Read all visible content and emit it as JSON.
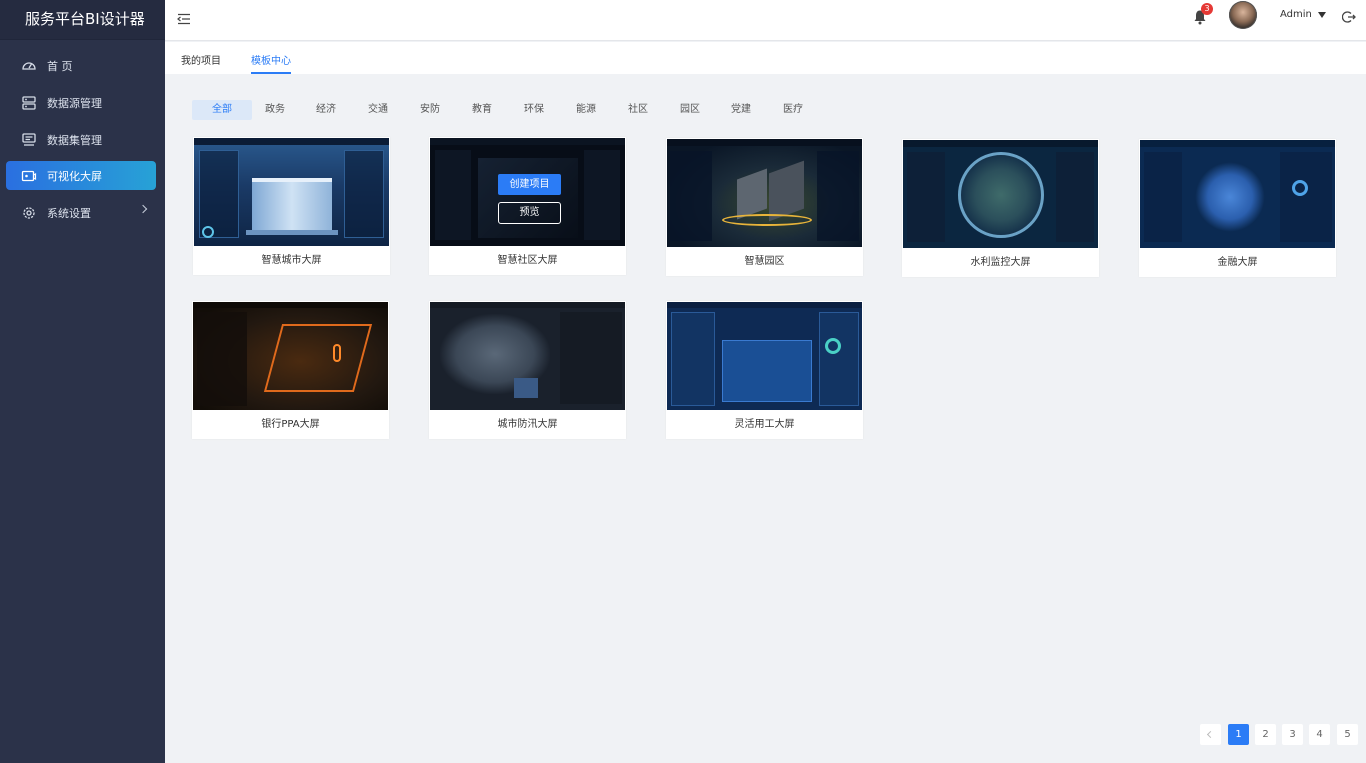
{
  "app": {
    "title": "服务平台BI设计器"
  },
  "sidebar": {
    "items": [
      {
        "label": "首 页",
        "icon": "dashboard-icon"
      },
      {
        "label": "数据源管理",
        "icon": "database-icon"
      },
      {
        "label": "数据集管理",
        "icon": "dataset-icon"
      },
      {
        "label": "可视化大屏",
        "icon": "screen-icon"
      },
      {
        "label": "系统设置",
        "icon": "gear-icon"
      }
    ]
  },
  "header": {
    "notif_count": "3",
    "user": "Admin"
  },
  "tabs": [
    "我的项目",
    "模板中心"
  ],
  "categories": [
    "全部",
    "政务",
    "经济",
    "交通",
    "安防",
    "教育",
    "环保",
    "能源",
    "社区",
    "园区",
    "党建",
    "医疗"
  ],
  "templates": [
    {
      "name": "智慧城市大屏",
      "theme": "#1c3a66"
    },
    {
      "name": "智慧社区大屏",
      "theme": "#0c1524"
    },
    {
      "name": "智慧园区",
      "theme": "#0c1d33"
    },
    {
      "name": "水利监控大屏",
      "theme": "#0b2640"
    },
    {
      "name": "金融大屏",
      "theme": "#0b2a52"
    },
    {
      "name": "银行PPA大屏",
      "theme": "#1b1510"
    },
    {
      "name": "城市防汛大屏",
      "theme": "#1a212c"
    },
    {
      "name": "灵活用工大屏",
      "theme": "#0e2a54"
    }
  ],
  "hover_actions": {
    "create": "创建项目",
    "preview": "预览"
  },
  "pagination": {
    "pages": [
      "1",
      "2",
      "3",
      "4",
      "5"
    ],
    "current": "1"
  }
}
